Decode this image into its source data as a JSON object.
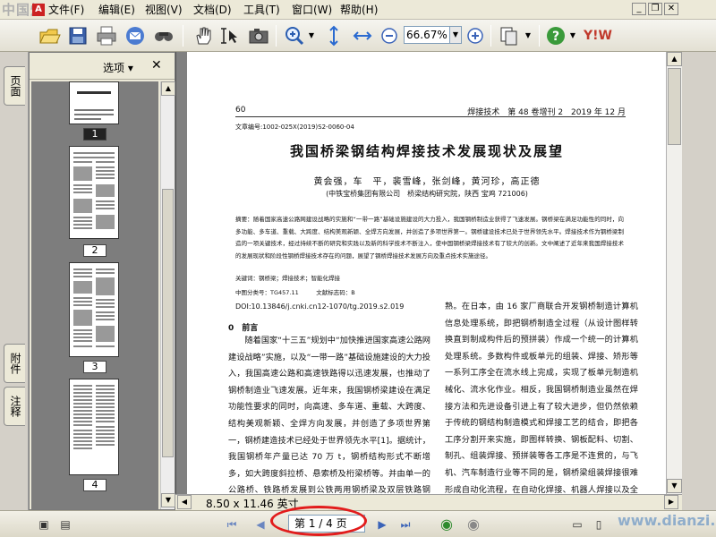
{
  "watermark_top_left": "中国焊",
  "watermark_bottom_right": "www.dianzi.com",
  "menu": {
    "items": [
      "文件(F)",
      "编辑(E)",
      "视图(V)",
      "文档(D)",
      "工具(T)",
      "窗口(W)",
      "帮助(H)"
    ]
  },
  "toolbar": {
    "zoom_value": "66.67%",
    "icons": [
      "open-icon",
      "save-icon",
      "print-icon",
      "email-icon",
      "search-icon",
      "hand-icon",
      "select-text-icon",
      "snapshot-icon",
      "zoom-in-tool-icon",
      "fit-page-icon",
      "fit-width-icon",
      "zoom-out-icon",
      "zoom-in-icon",
      "page-layout-icon",
      "help-icon",
      "brand-logo"
    ]
  },
  "left_tabs": {
    "pages": "页面",
    "attachments": "附件",
    "comments": "注释"
  },
  "panel": {
    "options_label": "选项",
    "close_label": "✕",
    "thumbnails": [
      {
        "label": "1",
        "selected": true
      },
      {
        "label": "2",
        "selected": false
      },
      {
        "label": "3",
        "selected": false
      },
      {
        "label": "4",
        "selected": false
      }
    ]
  },
  "document": {
    "page_number": "60",
    "journal_header": "焊接技术　第 48 卷增刊 2　2019 年 12 月",
    "article_no": "文章编号:1002-025X(2019)S2-0060-04",
    "title": "我国桥梁钢结构焊接技术发展现状及展望",
    "authors": "黄会强，车　平，裴雪峰，张剑峰，黄河珍，高正德",
    "affiliation": "(中铁宝桥集团有限公司　桥梁结构研究院，陕西 宝鸡 721006)",
    "abstract": "摘要：随着国家高速公路网建设战略的实施和“一带一路”基础设施建设的大力投入，我国钢桥制造业获得了飞速发展。钢桥梁在满足功能性的同时，向多功能、多车道、重载、大跨度、结构美观新颖、全焊方向发展，并创造了多项世界第一。钢桥建设技术已处于世界领先水平。焊接技术作为钢桥梁制造的一项关键技术，经过持续不断的研究和实践以及新的科学技术不断注入，使中国钢桥梁焊接技术有了较大的创新。文中阐述了近年来我国焊接技术的发展现状和阶段性钢桥焊接技术存在的问题，展望了钢桥焊接技术发展方向及重点技术实施途径。",
    "keywords": "关键词：钢桥梁；焊接技术；智能化焊接",
    "classification": "中图分类号：TG457.11　　　文献标志码：B",
    "doi": "DOI:10.13846/j.cnki.cn12-1070/tg.2019.s2.019",
    "section_heading": "0　前言",
    "col_left": "　　随着国家“十三五”规划中“加快推进国家高速公路网建设战略”实施，以及“一带一路”基础设施建设的大力投入，我国高速公路和高速铁路得以迅速发展，也推动了钢桥制造业飞速发展。近年来，我国钢桥梁建设在满足功能性要求的同时，向高速、多车道、重载、大跨度、结构美观新颖、全焊方向发展，并创造了多项世界第一，钢桥建造技术已经处于世界领先水平[1]。据统计，我国钢桥年产量已达 70 万 t，钢桥结构形式不断增多，如大跨度斜拉桥、悬索桥及桁梁桥等。并由单一的公路桥、铁路桥发展到公铁两用钢桥梁及双层铁路钢桥。钢",
    "col_right": "熟。在日本，由 16 家厂商联合开发钢桥制造计算机信息处理系统，即把钢桥制造全过程（从设计图样转换直到制成构件后的预拼装）作成一个统一的计算机处理系统。多数构件或板单元的组装、焊接、矫形等一系列工序全在流水线上完成，实现了板单元制造机械化、流水化作业。相反，我国钢桥制造业虽然在焊接方法和先进设备引进上有了较大进步，但仍然依赖于传统的钢结构制造模式和焊接工艺的结合，即把各工序分割开来实施，即图样转换、钢板配料、切割、制孔、组装焊接、预拼装等各工序是不连贯的，与飞机、汽车制造行业等不同的是，钢桥梁组装焊接很难形成自动化流程，在自动化焊接、机器人焊接以及全过程计算机连贯信息处理系"
  },
  "page_size_label": "8.50 x 11.46 英寸",
  "status": {
    "page_field": "第 1 / 4 页"
  },
  "colors": {
    "highlight_ring": "#e21c1c",
    "toolbar_bg": "#ece9d8"
  }
}
